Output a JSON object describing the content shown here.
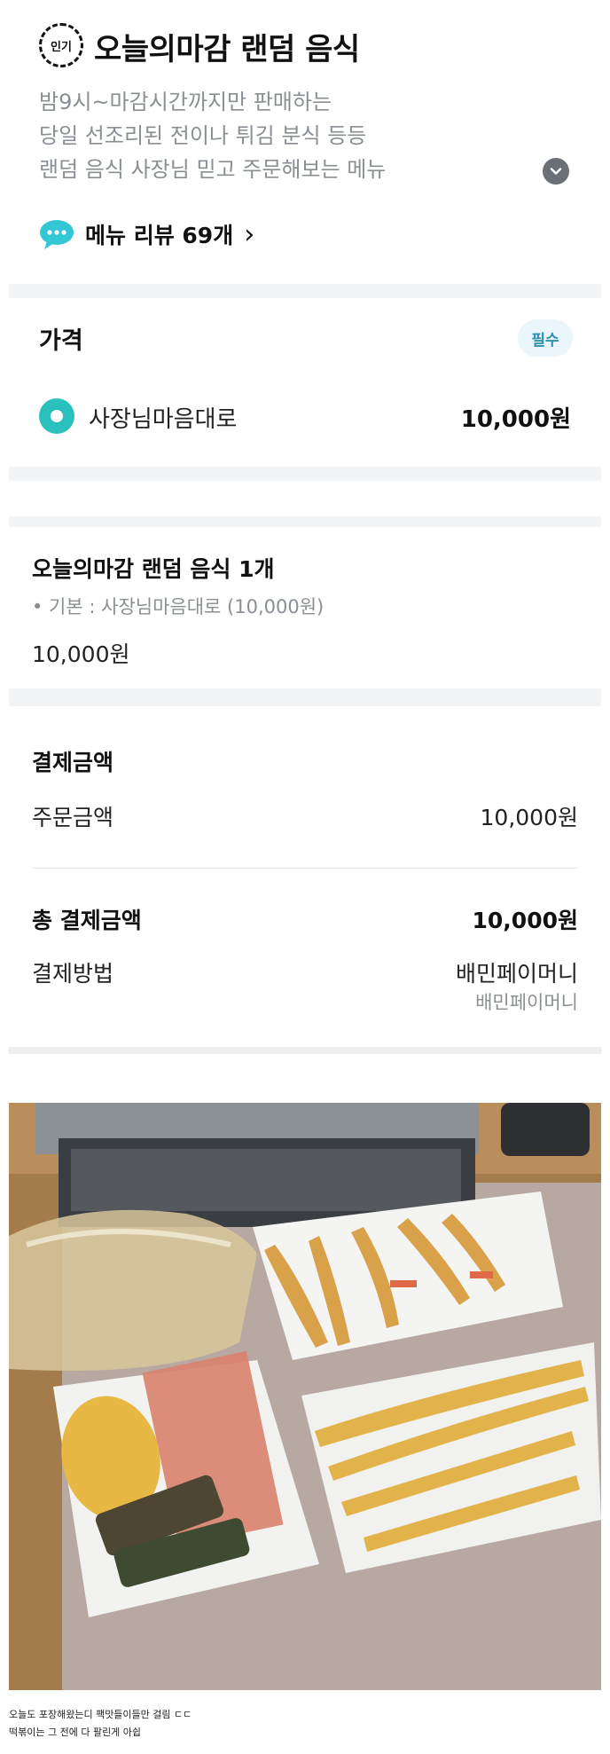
{
  "header": {
    "badge": "인기",
    "title": "오늘의마감 랜덤 음식",
    "description": [
      "밤9시~마감시간까지만 판매하는",
      "당일 선조리된 전이나 튀김 분식 등등",
      "랜덤 음식  사장님 믿고 주문해보는 메뉴"
    ],
    "review_link": "메뉴 리뷰 69개",
    "review_chevron": "›",
    "expand_icon": "chevron-down-icon"
  },
  "price_option": {
    "title": "가격",
    "required_badge": "필수",
    "option_label": "사장님마음대로",
    "option_price": "10,000원",
    "accent": "#2ac1bc"
  },
  "order": {
    "item_name": "오늘의마감 랜덤 음식 1개",
    "item_option": "• 기본 : 사장님마음대로 (10,000원)",
    "item_price": "10,000원"
  },
  "payment": {
    "title": "결제금액",
    "order_amount_label": "주문금액",
    "order_amount_value": "10,000원",
    "total_label": "총 결제금액",
    "total_value": "10,000원",
    "method_label": "결제방법",
    "method_value": "배민페이머니",
    "method_sub": "배민페이머니"
  },
  "photo": {
    "description_icon": "food-photo"
  },
  "caption": [
    "오늘도 포장해왔는디 팩맛들이들만 걸림 ㄷㄷ",
    "떡볶이는 그 전에 다 팔린게 아쉽"
  ]
}
